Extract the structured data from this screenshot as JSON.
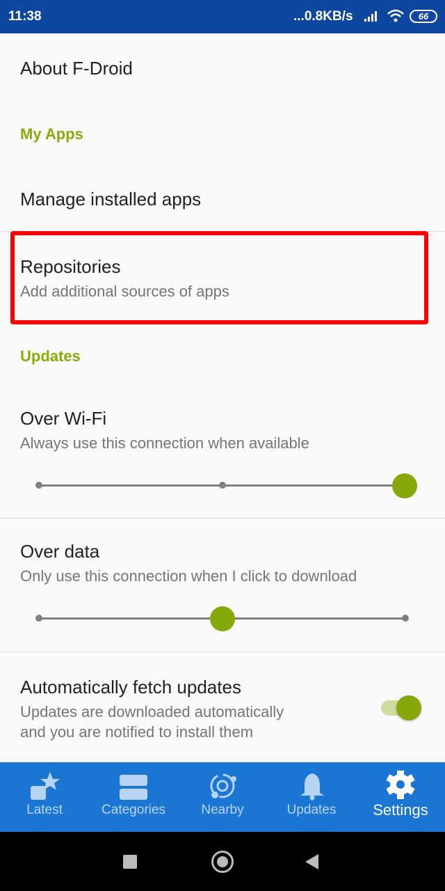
{
  "status_bar": {
    "time": "11:38",
    "network_speed": "...0.8KB/s",
    "battery": "66"
  },
  "settings": {
    "about": "About F-Droid",
    "my_apps_header": "My Apps",
    "manage_installed": "Manage installed apps",
    "repositories": {
      "title": "Repositories",
      "summary": "Add additional sources of apps"
    },
    "updates_header": "Updates",
    "over_wifi": {
      "title": "Over Wi-Fi",
      "summary": "Always use this connection when available",
      "level": 2,
      "max_level": 2
    },
    "over_data": {
      "title": "Over data",
      "summary": "Only use this connection when I click to download",
      "level": 1,
      "max_level": 2
    },
    "auto_fetch": {
      "title": "Automatically fetch updates",
      "summary_line1": "Updates are downloaded automatically",
      "summary_line2": "and you are notified to install them",
      "enabled": true
    }
  },
  "bottom_nav": {
    "items": [
      {
        "label": "Latest",
        "icon": "latest-star-icon"
      },
      {
        "label": "Categories",
        "icon": "categories-icon"
      },
      {
        "label": "Nearby",
        "icon": "nearby-icon"
      },
      {
        "label": "Updates",
        "icon": "bell-icon"
      },
      {
        "label": "Settings",
        "icon": "gear-icon",
        "active": true
      }
    ]
  },
  "colors": {
    "accent": "#8bab0c",
    "status_bar": "#0f47a0",
    "nav": "#1a76d2",
    "highlight": "#ff0000"
  }
}
